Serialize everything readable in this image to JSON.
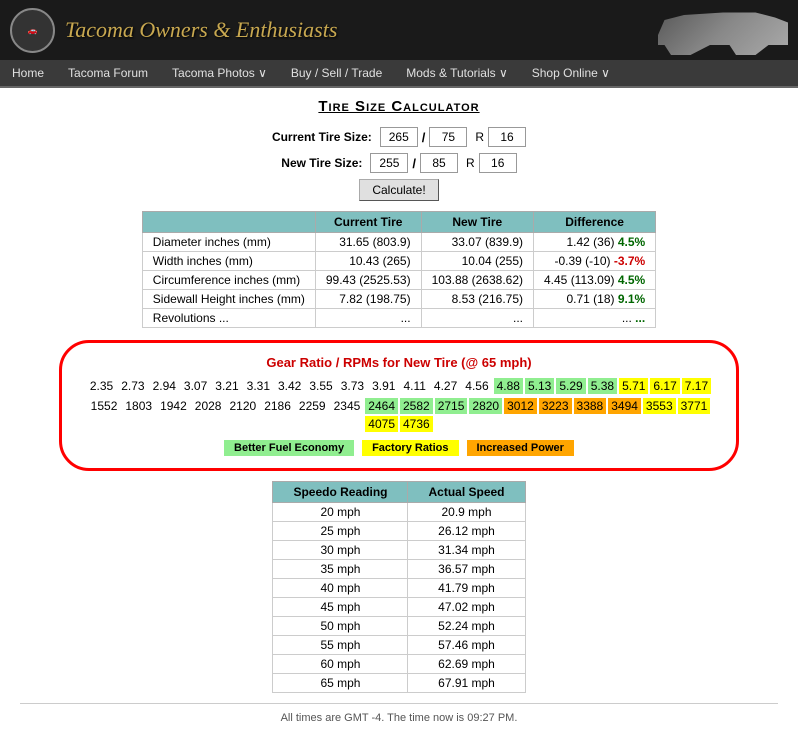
{
  "header": {
    "logo_text": "Tacoma Owners & Enthusiasts"
  },
  "nav": {
    "items": [
      {
        "label": "Home",
        "has_dropdown": false
      },
      {
        "label": "Tacoma Forum",
        "has_dropdown": false
      },
      {
        "label": "Tacoma Photos ∨",
        "has_dropdown": true
      },
      {
        "label": "Buy / Sell / Trade",
        "has_dropdown": false
      },
      {
        "label": "Mods & Tutorials ∨",
        "has_dropdown": true
      },
      {
        "label": "Shop Online ∨",
        "has_dropdown": true
      }
    ]
  },
  "page": {
    "title": "Tire Size Calculator"
  },
  "form": {
    "current_label": "Current Tire Size:",
    "new_label": "New Tire Size:",
    "current_val1": "265",
    "current_val2": "75",
    "current_r": "R",
    "current_val3": "16",
    "new_val1": "255",
    "new_val2": "85",
    "new_r": "R",
    "new_val3": "16",
    "calculate_btn": "Calculate!"
  },
  "results": {
    "headers": [
      "",
      "Current Tire",
      "New Tire",
      "Difference"
    ],
    "rows": [
      {
        "label": "Diameter inches (mm)",
        "current": "31.65 (803.9)",
        "new": "33.07 (839.9)",
        "diff": "1.42 (36)",
        "diff_pct": "4.5%",
        "diff_type": "positive"
      },
      {
        "label": "Width inches (mm)",
        "current": "10.43 (265)",
        "new": "10.04 (255)",
        "diff": "-0.39 (-10)",
        "diff_pct": "-3.7%",
        "diff_type": "negative"
      },
      {
        "label": "Circumference inches (mm)",
        "current": "99.43 (2525.53)",
        "new": "103.88 (2638.62)",
        "diff": "4.45 (113.09)",
        "diff_pct": "4.5%",
        "diff_type": "positive"
      },
      {
        "label": "Sidewall Height inches (mm)",
        "current": "7.82 (198.75)",
        "new": "8.53 (216.75)",
        "diff": "0.71 (18)",
        "diff_pct": "9.1%",
        "diff_type": "positive"
      },
      {
        "label": "Revolutions ...",
        "current": "...",
        "new": "...",
        "diff": "...",
        "diff_pct": "...",
        "diff_type": "positive"
      }
    ]
  },
  "gear": {
    "title": "Gear Ratio / RPMs for New Tire (@ 65 mph)",
    "ratios": [
      {
        "val": "2.35",
        "color": "none"
      },
      {
        "val": "2.73",
        "color": "none"
      },
      {
        "val": "2.94",
        "color": "none"
      },
      {
        "val": "3.07",
        "color": "none"
      },
      {
        "val": "3.21",
        "color": "none"
      },
      {
        "val": "3.31",
        "color": "none"
      },
      {
        "val": "3.42",
        "color": "none"
      },
      {
        "val": "3.55",
        "color": "none"
      },
      {
        "val": "3.73",
        "color": "none"
      },
      {
        "val": "3.91",
        "color": "none"
      },
      {
        "val": "4.11",
        "color": "none"
      },
      {
        "val": "4.27",
        "color": "none"
      },
      {
        "val": "4.56",
        "color": "none"
      },
      {
        "val": "4.88",
        "color": "green"
      },
      {
        "val": "5.13",
        "color": "green"
      },
      {
        "val": "5.29",
        "color": "green"
      },
      {
        "val": "5.38",
        "color": "green"
      },
      {
        "val": "5.71",
        "color": "yellow"
      },
      {
        "val": "6.17",
        "color": "yellow"
      },
      {
        "val": "7.17",
        "color": "yellow"
      }
    ],
    "rpms": [
      {
        "val": "1552",
        "color": "none"
      },
      {
        "val": "1803",
        "color": "none"
      },
      {
        "val": "1942",
        "color": "none"
      },
      {
        "val": "2028",
        "color": "none"
      },
      {
        "val": "2120",
        "color": "none"
      },
      {
        "val": "2186",
        "color": "none"
      },
      {
        "val": "2259",
        "color": "none"
      },
      {
        "val": "2345",
        "color": "none"
      },
      {
        "val": "2464",
        "color": "green"
      },
      {
        "val": "2582",
        "color": "green"
      },
      {
        "val": "2715",
        "color": "green"
      },
      {
        "val": "2820",
        "color": "green"
      },
      {
        "val": "3012",
        "color": "orange"
      },
      {
        "val": "3223",
        "color": "orange"
      },
      {
        "val": "3388",
        "color": "orange"
      },
      {
        "val": "3494",
        "color": "orange"
      },
      {
        "val": "3553",
        "color": "yellow"
      },
      {
        "val": "3771",
        "color": "yellow"
      },
      {
        "val": "4075",
        "color": "yellow"
      },
      {
        "val": "4736",
        "color": "yellow"
      }
    ],
    "legend": [
      {
        "label": "Better Fuel Economy",
        "color": "green"
      },
      {
        "label": "Factory Ratios",
        "color": "yellow"
      },
      {
        "label": "Increased Power",
        "color": "orange"
      }
    ]
  },
  "speedo": {
    "headers": [
      "Speedo Reading",
      "Actual Speed"
    ],
    "rows": [
      {
        "speedo": "20 mph",
        "actual": "20.9 mph"
      },
      {
        "speedo": "25 mph",
        "actual": "26.12 mph"
      },
      {
        "speedo": "30 mph",
        "actual": "31.34 mph"
      },
      {
        "speedo": "35 mph",
        "actual": "36.57 mph"
      },
      {
        "speedo": "40 mph",
        "actual": "41.79 mph"
      },
      {
        "speedo": "45 mph",
        "actual": "47.02 mph"
      },
      {
        "speedo": "50 mph",
        "actual": "52.24 mph"
      },
      {
        "speedo": "55 mph",
        "actual": "57.46 mph"
      },
      {
        "speedo": "60 mph",
        "actual": "62.69 mph"
      },
      {
        "speedo": "65 mph",
        "actual": "67.91 mph"
      }
    ]
  },
  "footer": {
    "text": "All times are GMT -4. The time now is 09:27 PM."
  }
}
